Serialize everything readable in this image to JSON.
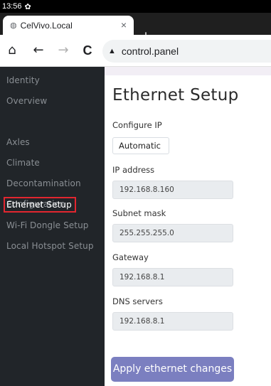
{
  "status_bar": {
    "time": "13:56",
    "settings_icon": "gear-icon"
  },
  "browser": {
    "tab": {
      "title": "CelVivo.Local",
      "close_glyph": "×"
    },
    "new_tab_glyph": "+",
    "url": "control.panel",
    "nav": {
      "home": "⌂",
      "back": "←",
      "forward": "→",
      "reload": "C"
    }
  },
  "sidebar": {
    "items": [
      {
        "label": "Identity"
      },
      {
        "label": "Overview"
      },
      {
        "label": "Axles"
      },
      {
        "label": "Climate"
      },
      {
        "label": "Decontamination"
      },
      {
        "label": "Configuration"
      },
      {
        "label": "Ethernet Setup"
      },
      {
        "label": "Wi-Fi Dongle Setup"
      },
      {
        "label": "Local Hotspot Setup"
      }
    ],
    "active_index": 6
  },
  "main": {
    "title": "Ethernet Setup",
    "configure_ip": {
      "label": "Configure IP",
      "value": "Automatic"
    },
    "ip_address": {
      "label": "IP address",
      "value": "192.168.8.160"
    },
    "subnet_mask": {
      "label": "Subnet mask",
      "value": "255.255.255.0"
    },
    "gateway": {
      "label": "Gateway",
      "value": "192.168.8.1"
    },
    "dns_servers": {
      "label": "DNS servers",
      "value": "192.168.8.1"
    },
    "apply_button": "Apply ethernet changes"
  },
  "colors": {
    "sidebar_bg": "#212529",
    "sidebar_text": "#8a8f94",
    "highlight": "#e2262f",
    "button": "#7b7fc0"
  }
}
